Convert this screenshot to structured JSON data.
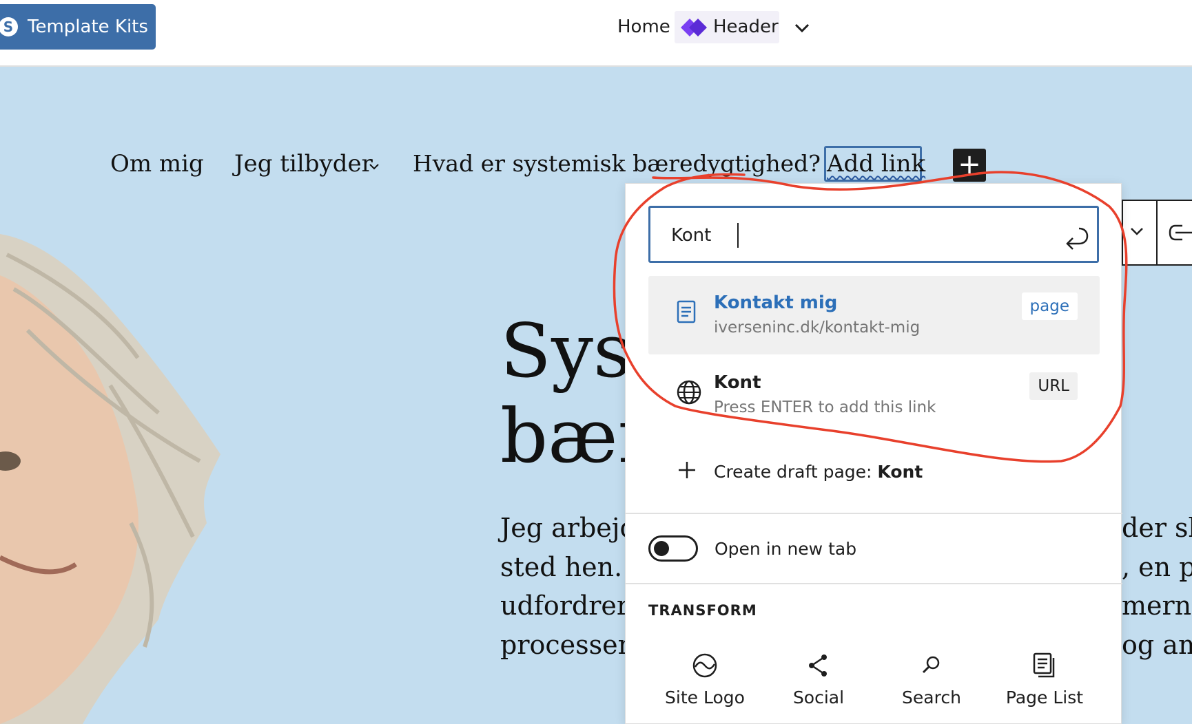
{
  "topbar": {
    "kits_label": "Template Kits",
    "home_label": "Home",
    "header_label": "Header"
  },
  "nav": {
    "items": [
      "Om mig",
      "Jeg tilbyder",
      "Hvad er systemisk bæredygtighed?"
    ],
    "add_link": "Add link"
  },
  "hero": {
    "title_line1": "Sys",
    "title_line2": "bær",
    "body_left": [
      "Jeg arbejd",
      "sted hen. I",
      "udfordrer",
      "processen"
    ],
    "body_right": [
      "der sk",
      ", en pr",
      "merne",
      "og am"
    ]
  },
  "popover": {
    "search_value": "Kont",
    "results": [
      {
        "title": "Kontakt mig",
        "subtitle": "iverseninc.dk/kontakt-mig",
        "badge": "page"
      },
      {
        "title": "Kont",
        "subtitle": "Press ENTER to add this link",
        "badge": "URL"
      }
    ],
    "create_prefix": "Create draft page: ",
    "create_value": "Kont",
    "open_new_tab_label": "Open in new tab",
    "open_new_tab_checked": false,
    "transform_heading": "TRANSFORM",
    "transform_items": [
      "Site Logo",
      "Social",
      "Search",
      "Page List"
    ]
  },
  "colors": {
    "accent": "#3d6ea8",
    "link": "#2c6fb8",
    "hero_bg": "#c3ddef",
    "annotation": "#e8402c"
  }
}
